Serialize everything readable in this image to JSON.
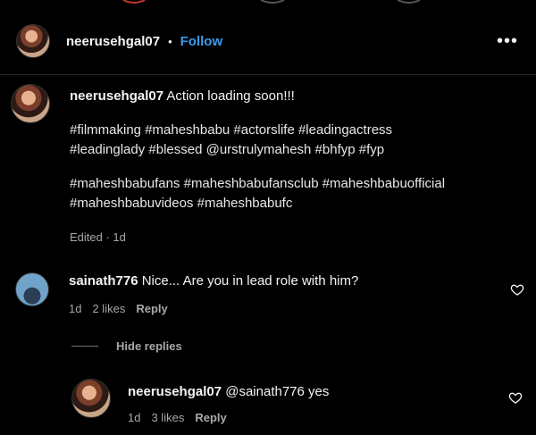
{
  "header": {
    "username": "neerusehgal07",
    "separator": "•",
    "follow_label": "Follow",
    "more_label": "•••"
  },
  "caption": {
    "username": "neerusehgal07",
    "text": "Action loading soon!!!",
    "hashtags_line1": "#filmmaking #maheshbabu #actorslife #leadingactress",
    "hashtags_line2": "#leadinglady #blessed @urstrulymahesh #bhfyp #fyp",
    "hashtags_line3": "#maheshbabufans #maheshbabufansclub #maheshbabuofficial",
    "hashtags_line4": "#maheshbabuvideos #maheshbabufc",
    "meta": "Edited · 1d"
  },
  "comment": {
    "username": "sainath776",
    "text": "Nice... Are you in lead role with him?",
    "time": "1d",
    "likes": "2 likes",
    "reply_label": "Reply"
  },
  "hide_replies_label": "Hide replies",
  "reply": {
    "username": "neerusehgal07",
    "text": "@sainath776 yes",
    "time": "1d",
    "likes": "3 likes",
    "reply_label": "Reply"
  },
  "icons": {
    "heart": "heart-outline-icon",
    "more": "more-horizontal-icon"
  },
  "colors": {
    "background": "#000000",
    "accent": "#3b9cf0",
    "secondary_text": "#a8a8a8"
  }
}
